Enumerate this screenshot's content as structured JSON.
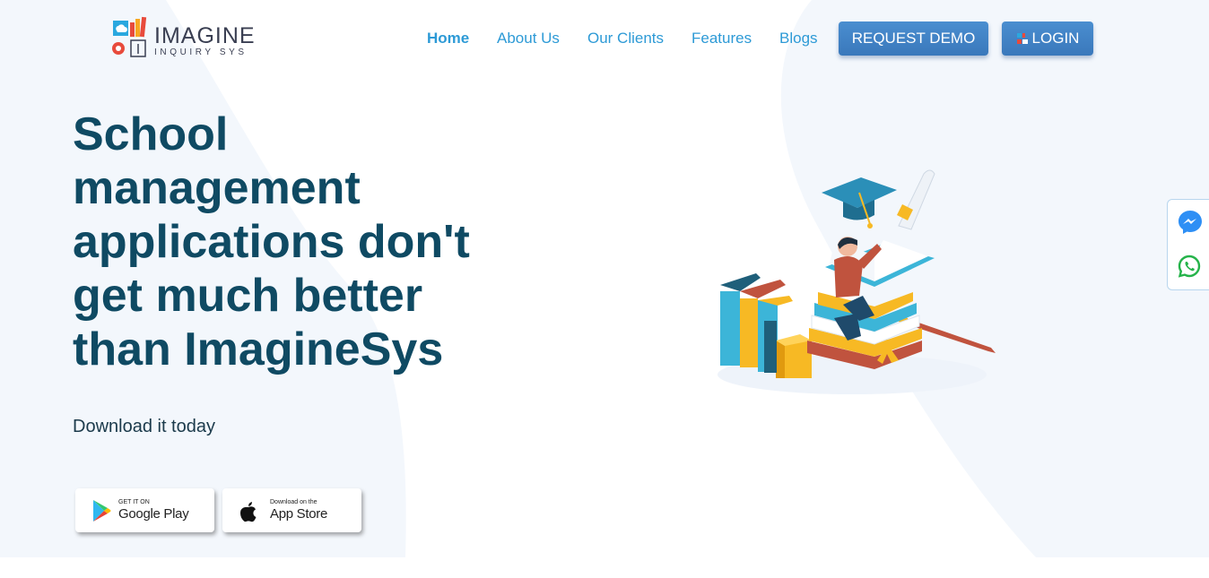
{
  "brand": {
    "title": "IMAGINE",
    "subtitle": "INQUIRY SYS"
  },
  "nav": {
    "items": [
      {
        "label": "Home",
        "active": true
      },
      {
        "label": "About Us",
        "active": false
      },
      {
        "label": "Our Clients",
        "active": false
      },
      {
        "label": "Features",
        "active": false
      },
      {
        "label": "Blogs",
        "active": false
      }
    ],
    "request_demo_label": "REQUEST DEMO",
    "login_label": "LOGIN"
  },
  "hero": {
    "title_lines": [
      "School",
      "management",
      "applications don't",
      "get much better",
      "than ImagineSys"
    ],
    "subtitle": "Download it today"
  },
  "stores": {
    "google_play": {
      "small": "GET IT ON",
      "big": "Google Play"
    },
    "app_store": {
      "small": "Download on the",
      "big": "App Store"
    }
  },
  "side_widget": {
    "icons": [
      "messenger-icon",
      "whatsapp-icon"
    ]
  },
  "colors": {
    "nav_link": "#2d9ad6",
    "button": "#4183c4",
    "hero_title": "#0f4a63",
    "background_shape": "#f3f7fc"
  }
}
